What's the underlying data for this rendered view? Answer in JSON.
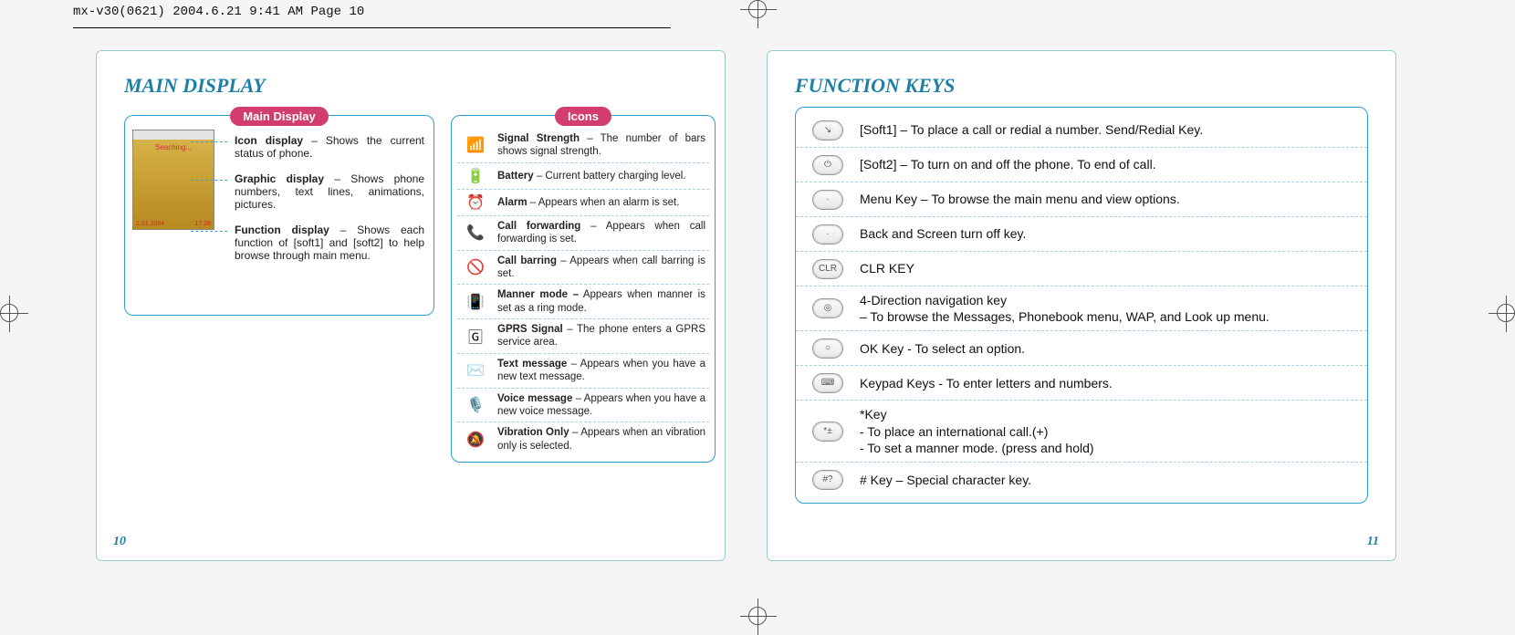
{
  "header": "mx-v30(0621)  2004.6.21  9:41 AM  Page 10",
  "page_left_number": "10",
  "page_right_number": "11",
  "left": {
    "title": "MAIN DISPLAY",
    "main_display_label": "Main Display",
    "icons_label": "Icons",
    "phone_status_text": "Seaching...",
    "phone_date": "1.01.2004",
    "phone_time": "17:28",
    "display_items": [
      {
        "bold": "Icon display",
        "rest": " – Shows the current status of phone."
      },
      {
        "bold": "Graphic display",
        "rest": " – Shows phone numbers, text lines, animations, pictures."
      },
      {
        "bold": "Function display",
        "rest": " – Shows each function of [soft1] and [soft2] to help browse through main menu."
      }
    ],
    "icon_rows": [
      {
        "glyph": "📶",
        "bold": "Signal Strength",
        "rest": " – The number of bars shows signal strength."
      },
      {
        "glyph": "🔋",
        "bold": "Battery",
        "rest": " – Current battery charging level."
      },
      {
        "glyph": "⏰",
        "bold": "Alarm",
        "rest": " – Appears when an alarm is set."
      },
      {
        "glyph": "📞",
        "bold": "Call forwarding",
        "rest": " – Appears when call forwarding is set."
      },
      {
        "glyph": "🚫",
        "bold": "Call barring",
        "rest": " – Appears when call barring is set."
      },
      {
        "glyph": "📳",
        "bold": "Manner mode –",
        "rest": " Appears when manner is set as a ring mode."
      },
      {
        "glyph": "🄶",
        "bold": "GPRS Signal",
        "rest": " – The phone enters a GPRS service area."
      },
      {
        "glyph": "✉️",
        "bold": "Text message",
        "rest": " – Appears when you have a new text message."
      },
      {
        "glyph": "🎙️",
        "bold": "Voice message",
        "rest": " – Appears when you have a new voice message."
      },
      {
        "glyph": "🔕",
        "bold": "Vibration Only",
        "rest": " – Appears when an vibration only is selected."
      }
    ]
  },
  "right": {
    "title": "FUNCTION KEYS",
    "key_rows": [
      {
        "btn": "↘",
        "desc": "[Soft1] – To place a call or redial a number. Send/Redial Key."
      },
      {
        "btn": "⏻",
        "desc": "[Soft2] – To turn on and off the phone. To end of call."
      },
      {
        "btn": "·",
        "desc": "Menu Key  – To browse the main menu and view options."
      },
      {
        "btn": "·",
        "desc": "Back and Screen turn off key."
      },
      {
        "btn": "CLR",
        "desc": "CLR KEY"
      },
      {
        "btn": "◎",
        "desc": "4-Direction navigation key\n – To browse the Messages, Phonebook menu, WAP, and Look up menu."
      },
      {
        "btn": "○",
        "desc": "OK Key - To select an option."
      },
      {
        "btn": "⌨",
        "desc": "Keypad Keys - To enter letters and numbers."
      },
      {
        "btn": "*±",
        "desc": "*Key\n- To place an international call.(+)\n- To set a manner mode. (press and hold)"
      },
      {
        "btn": "#?",
        "desc": "# Key – Special character key."
      }
    ]
  }
}
